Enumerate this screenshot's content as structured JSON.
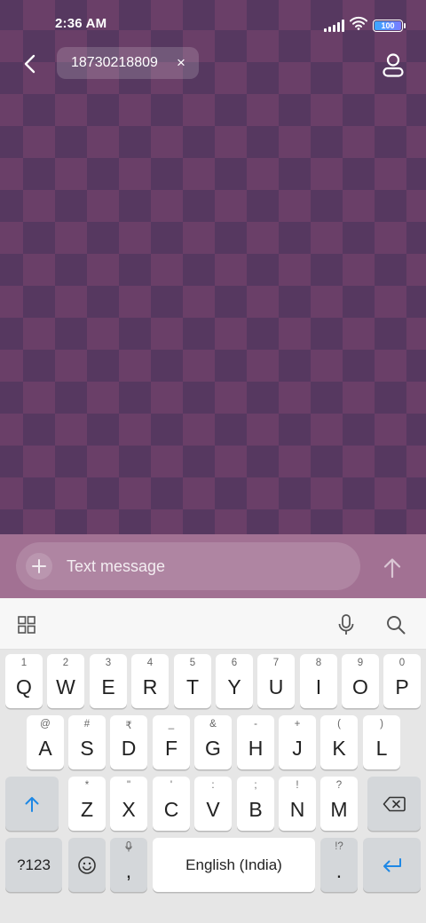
{
  "status_bar": {
    "time": "2:36 AM",
    "battery_level": "100"
  },
  "header": {
    "recipient": "18730218809",
    "remove_glyph": "×"
  },
  "compose": {
    "placeholder": "Text message"
  },
  "keyboard": {
    "row1": [
      {
        "hint": "1",
        "key": "Q"
      },
      {
        "hint": "2",
        "key": "W"
      },
      {
        "hint": "3",
        "key": "E"
      },
      {
        "hint": "4",
        "key": "R"
      },
      {
        "hint": "5",
        "key": "T"
      },
      {
        "hint": "6",
        "key": "Y"
      },
      {
        "hint": "7",
        "key": "U"
      },
      {
        "hint": "8",
        "key": "I"
      },
      {
        "hint": "9",
        "key": "O"
      },
      {
        "hint": "0",
        "key": "P"
      }
    ],
    "row2": [
      {
        "hint": "@",
        "key": "A"
      },
      {
        "hint": "#",
        "key": "S"
      },
      {
        "hint": "₹",
        "key": "D"
      },
      {
        "hint": "_",
        "key": "F"
      },
      {
        "hint": "&",
        "key": "G"
      },
      {
        "hint": "-",
        "key": "H"
      },
      {
        "hint": "+",
        "key": "J"
      },
      {
        "hint": "(",
        "key": "K"
      },
      {
        "hint": ")",
        "key": "L"
      }
    ],
    "row3": [
      {
        "hint": "*",
        "key": "Z"
      },
      {
        "hint": "\"",
        "key": "X"
      },
      {
        "hint": "'",
        "key": "C"
      },
      {
        "hint": ":",
        "key": "V"
      },
      {
        "hint": ";",
        "key": "B"
      },
      {
        "hint": "!",
        "key": "N"
      },
      {
        "hint": "?",
        "key": "M"
      }
    ],
    "row4": {
      "symbols_label": "?123",
      "comma": ",",
      "space_label": "English (India)",
      "period_hint": "!?",
      "period": "."
    }
  },
  "colors": {
    "accent": "#1e88e5",
    "chat_bg_dark": "#563860",
    "chat_bg_light": "#6a3f68",
    "compose_bg": "#a27193"
  }
}
